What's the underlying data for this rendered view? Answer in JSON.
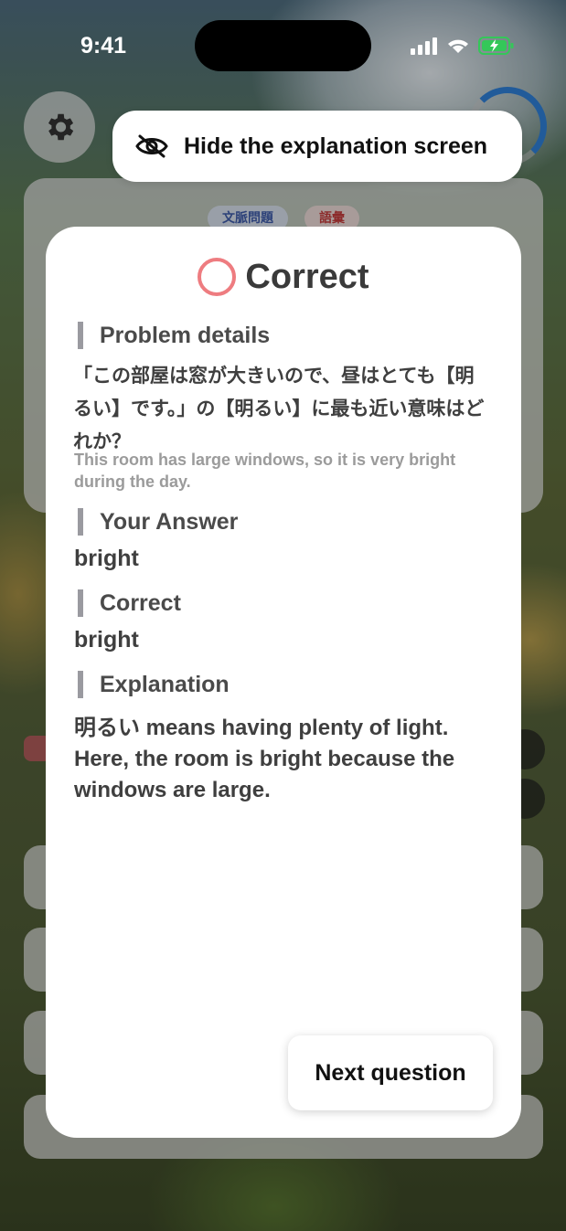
{
  "status_bar": {
    "time": "9:41"
  },
  "background_tags": {
    "category": "文脈問題",
    "type": "語彙"
  },
  "hide_explanation": {
    "label": "Hide the explanation screen",
    "icon": "eye-slash-icon"
  },
  "result": {
    "label": "Correct",
    "icon": "circle-correct-icon",
    "color": "#ee7c80"
  },
  "problem": {
    "heading": "Problem details",
    "question_jp": "「この部屋は窓が大きいので、昼はとても【明るい】です。」の【明るい】に最も近い意味はどれか？",
    "question_en": "This room has large windows, so it is very bright during the day."
  },
  "your_answer": {
    "heading": "Your Answer",
    "value": "bright"
  },
  "correct_answer": {
    "heading": "Correct",
    "value": "bright"
  },
  "explanation": {
    "heading": "Explanation",
    "text": "明るい means having plenty of light. Here, the room is bright because the windows are large."
  },
  "next_button": {
    "label": "Next question"
  },
  "colors": {
    "accent_blue": "#2f7fd6",
    "battery_green": "#34c759"
  }
}
